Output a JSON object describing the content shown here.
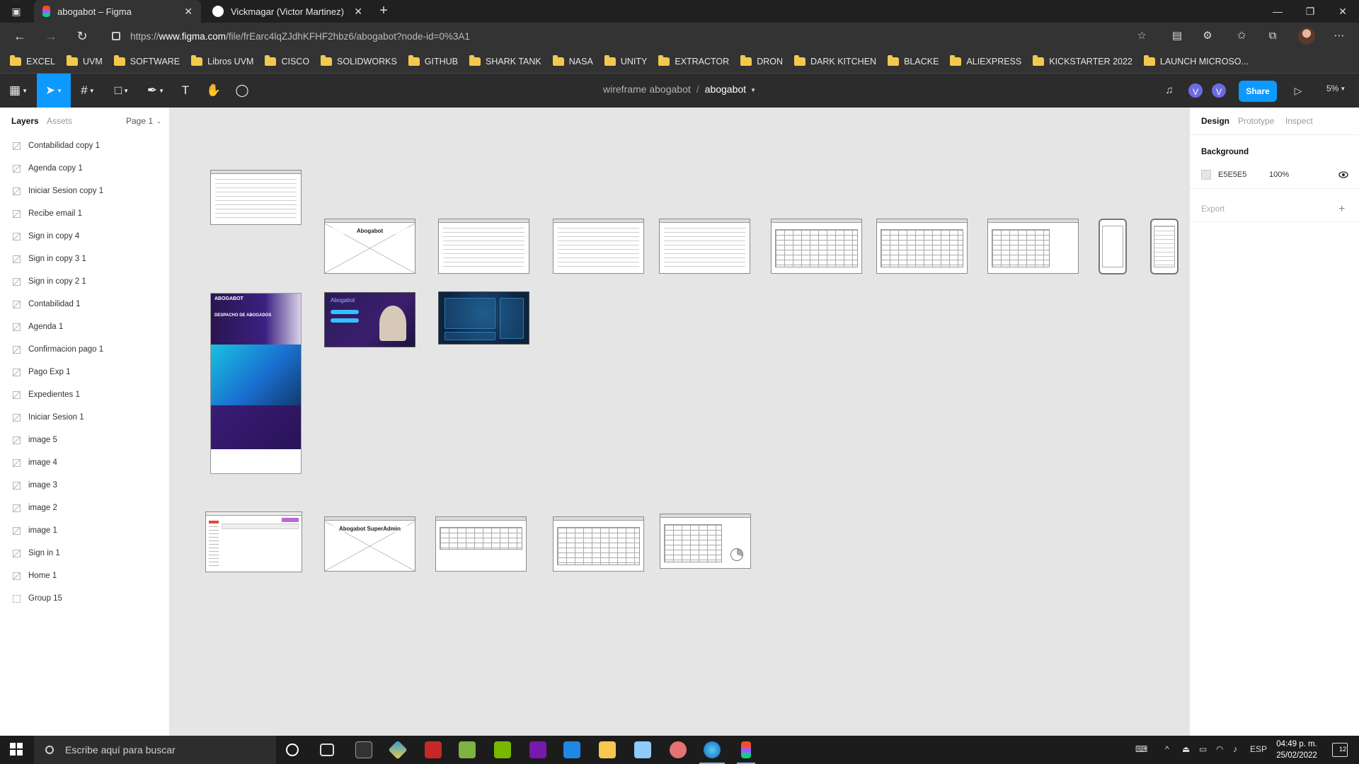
{
  "browser": {
    "tabs": [
      {
        "title": "abogabot – Figma",
        "active": true
      },
      {
        "title": "Vickmagar (Victor Martinez)",
        "active": false
      }
    ],
    "url_prefix": "https://",
    "url_host": "www.figma.com",
    "url_path": "/file/frEarc4lqZJdhKFHF2hbz6/abogabot?node-id=0%3A1",
    "bookmarks": [
      "EXCEL",
      "UVM",
      "SOFTWARE",
      "Libros UVM",
      "CISCO",
      "SOLIDWORKS",
      "GITHUB",
      "SHARK TANK",
      "NASA",
      "UNITY",
      "EXTRACTOR",
      "DRON",
      "DARK KITCHEN",
      "BLACKE",
      "ALIEXPRESS",
      "KICKSTARTER 2022",
      "LAUNCH MICROSO..."
    ]
  },
  "figma": {
    "project_name": "wireframe abogabot",
    "path_separator": "/",
    "file_name": "abogabot",
    "avatars": [
      "V",
      "V"
    ],
    "share_label": "Share",
    "zoom": "5%",
    "left_panel": {
      "tabs": [
        "Layers",
        "Assets"
      ],
      "page": "Page 1",
      "layers": [
        "Contabilidad copy 1",
        "Agenda copy 1",
        "Iniciar Sesion copy 1",
        "Recibe email 1",
        "Sign in copy 4",
        "Sign in copy 3 1",
        "Sign in copy 2 1",
        "Contabilidad 1",
        "Agenda 1",
        "Confirmacion pago 1",
        "Pago Exp 1",
        "Expedientes 1",
        "Iniciar Sesion 1",
        "image 5",
        "image 4",
        "image 3",
        "image 2",
        "image 1",
        "Sign in 1",
        "Home 1",
        "Group 15"
      ]
    },
    "right_panel": {
      "tabs": [
        "Design",
        "Prototype",
        "Inspect"
      ],
      "background_label": "Background",
      "background_hex": "E5E5E5",
      "background_opacity": "100%",
      "export_label": "Export"
    },
    "canvas": {
      "background_color": "#e5e5e5",
      "frame_captions": {
        "abogabot": "Abogabot",
        "superadmin": "Abogabot SuperAdmin",
        "landing_title": "ABOGABOT",
        "landing_hero": "DESPACHO DE ABOGADOS",
        "purple_title": "Abogabot"
      }
    },
    "help": "?"
  },
  "taskbar": {
    "search_placeholder": "Escribe aquí para buscar",
    "language": "ESP",
    "time": "04:49 p. m.",
    "date": "25/02/2022",
    "notifications": "12"
  },
  "colors": {
    "figma_accent": "#0d99ff",
    "canvas_bg": "#e5e5e5"
  }
}
